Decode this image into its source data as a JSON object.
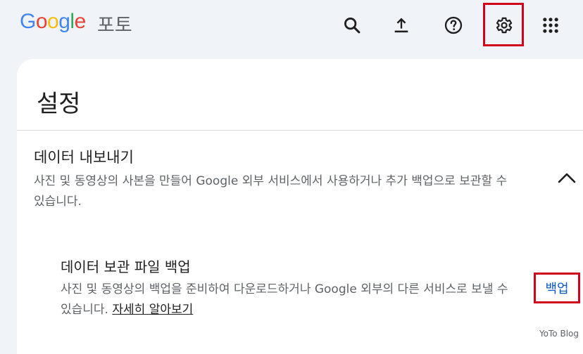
{
  "header": {
    "logo_letters": [
      {
        "char": "G",
        "color": "#4285f4"
      },
      {
        "char": "o",
        "color": "#ea4335"
      },
      {
        "char": "o",
        "color": "#fbbc05"
      },
      {
        "char": "g",
        "color": "#4285f4"
      },
      {
        "char": "l",
        "color": "#34a853"
      },
      {
        "char": "e",
        "color": "#ea4335"
      }
    ],
    "product_name": "포토",
    "icons": [
      "search-icon",
      "upload-icon",
      "help-icon",
      "settings-icon",
      "apps-grid-icon"
    ],
    "highlight_color": "#d0021b"
  },
  "settings": {
    "title": "설정",
    "export": {
      "title": "데이터 내보내기",
      "description": "사진 및 동영상의 사본을 만들어 Google 외부 서비스에서 사용하거나 추가 백업으로 보관할 수 있습니다.",
      "expanded": true
    },
    "archive_backup": {
      "title": "데이터 보관 파일 백업",
      "description": "사진 및 동영상의 백업을 준비하여 다운로드하거나 Google 외부의 다른 서비스로 보낼 수 있습니다.",
      "learn_more": "자세히 알아보기",
      "button_label": "백업",
      "button_color": "#0b57d0"
    }
  },
  "watermark": "YoTo Blog"
}
